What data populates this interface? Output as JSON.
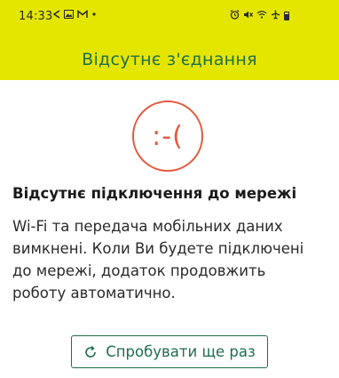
{
  "status_bar": {
    "time": "14:33",
    "left_icons": [
      {
        "name": "navigation-icon",
        "glyph": "⟨"
      },
      {
        "name": "gallery-icon",
        "glyph": "▣"
      },
      {
        "name": "gmail-icon",
        "glyph": "M"
      },
      {
        "name": "dot-icon",
        "glyph": "•"
      }
    ],
    "right_icons": [
      {
        "name": "alarm-icon",
        "glyph": "⏰"
      },
      {
        "name": "mute-icon",
        "glyph": "✕"
      },
      {
        "name": "wifi-off-icon",
        "glyph": "≋"
      },
      {
        "name": "airplane-icon",
        "glyph": "✈"
      }
    ]
  },
  "header": {
    "title": "Відсутнє з'єднання"
  },
  "error": {
    "face": ":-(",
    "heading": "Відсутнє підключення до мережі",
    "message": "Wi-Fi та передача мобільних даних вимкнені. Коли Ви будете підключені до мережі, додаток продовжить роботу автоматично."
  },
  "retry_button": {
    "label": "Спробувати ще раз",
    "icon": "refresh-icon"
  },
  "colors": {
    "header_bg": "#e4e600",
    "accent_green": "#1f6e4d",
    "error_red": "#e05a3f"
  }
}
